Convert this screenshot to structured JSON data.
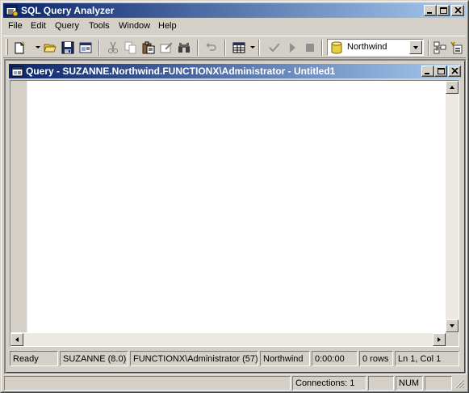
{
  "app": {
    "title": "SQL Query Analyzer",
    "icon": "sql-query-analyzer-icon"
  },
  "menubar": {
    "items": [
      "File",
      "Edit",
      "Query",
      "Tools",
      "Window",
      "Help"
    ]
  },
  "toolbar": {
    "database_selected": "Northwind",
    "buttons": [
      "new-query-icon",
      "open-icon",
      "save-icon",
      "load-script-icon",
      "cut-icon",
      "copy-icon",
      "paste-icon",
      "clear-window-icon",
      "find-icon",
      "undo-icon",
      "results-mode-icon",
      "parse-icon",
      "execute-icon",
      "cancel-query-icon",
      "object-browser-icon",
      "object-search-icon"
    ]
  },
  "query_window": {
    "title": "Query - SUZANNE.Northwind.FUNCTIONX\\Administrator - Untitled1",
    "editor_text": ""
  },
  "query_status": {
    "state": "Ready",
    "server": "SUZANNE (8.0)",
    "user": "FUNCTIONX\\Administrator (57)",
    "database": "Northwind",
    "elapsed": "0:00:00",
    "rows": "0 rows",
    "position": "Ln 1, Col 1"
  },
  "app_status": {
    "connections": "Connections: 1",
    "num": "NUM"
  },
  "colors": {
    "titlebar_start": "#0a246a",
    "titlebar_end": "#a6caf0",
    "face": "#d4d0c8",
    "mdi_background": "#808080"
  }
}
